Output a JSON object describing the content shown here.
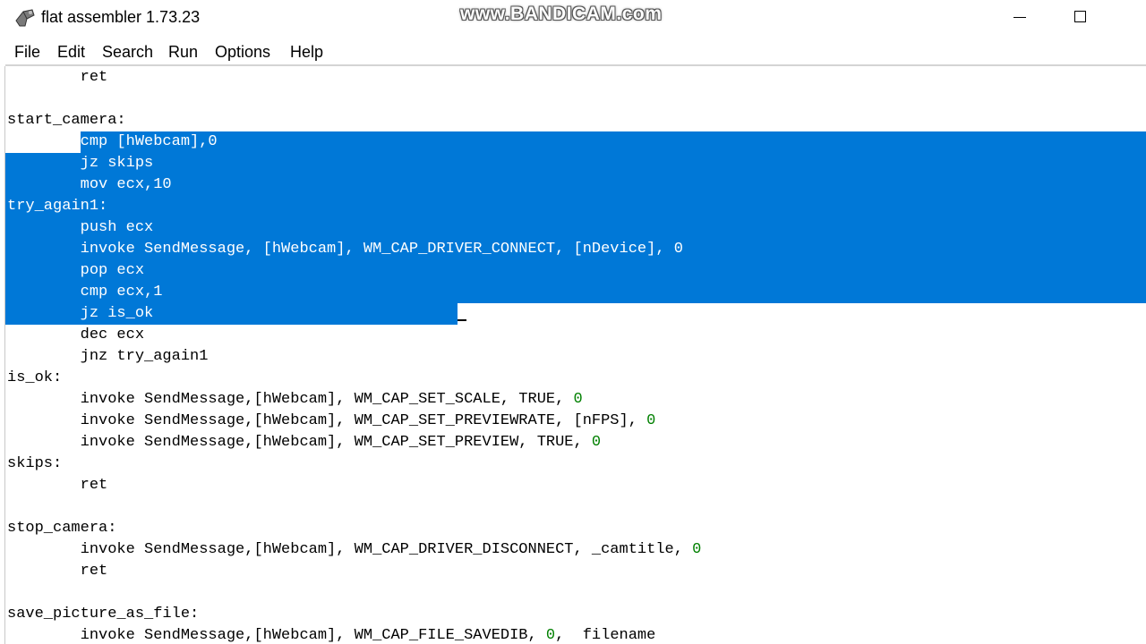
{
  "window": {
    "title": "flat assembler 1.73.23",
    "watermark": "www.BANDICAM.com",
    "app_icon": "fasm-icon",
    "controls": [
      "minimize-icon",
      "maximize-icon"
    ]
  },
  "menu": [
    "File",
    "Edit",
    "Search",
    "Run",
    "Options",
    "Help"
  ],
  "colors": {
    "selection": "#0078d7",
    "number": "#008000",
    "text": "#000000"
  },
  "editor": {
    "lines": [
      {
        "text": "        ret"
      },
      {
        "text": ""
      },
      {
        "text": "start_camera:"
      },
      {
        "text": "        cmp [hWebcam],0",
        "selected": true
      },
      {
        "text": "        jz skips",
        "selected": true
      },
      {
        "text": "        mov ecx,10",
        "selected": true
      },
      {
        "text": "try_again1:",
        "selected": true
      },
      {
        "text": "        push ecx",
        "selected": true
      },
      {
        "text": "        invoke SendMessage, [hWebcam], WM_CAP_DRIVER_CONNECT, [nDevice], 0",
        "selected": true
      },
      {
        "text": "        pop ecx",
        "selected": true
      },
      {
        "text": "        cmp ecx,1",
        "selected": true
      },
      {
        "text": "        jz is_ok",
        "selected": true
      },
      {
        "text": "        dec ecx"
      },
      {
        "text": "        jnz try_again1"
      },
      {
        "text": "is_ok:"
      },
      {
        "text": "        invoke SendMessage,[hWebcam], WM_CAP_SET_SCALE, TRUE, ",
        "tail": "0"
      },
      {
        "text": "        invoke SendMessage,[hWebcam], WM_CAP_SET_PREVIEWRATE, [nFPS], ",
        "tail": "0"
      },
      {
        "text": "        invoke SendMessage,[hWebcam], WM_CAP_SET_PREVIEW, TRUE, ",
        "tail": "0"
      },
      {
        "text": "skips:"
      },
      {
        "text": "        ret"
      },
      {
        "text": ""
      },
      {
        "text": "stop_camera:"
      },
      {
        "text": "        invoke SendMessage,[hWebcam], WM_CAP_DRIVER_DISCONNECT, _camtitle, ",
        "tail": "0"
      },
      {
        "text": "        ret"
      },
      {
        "text": ""
      },
      {
        "text": "save_picture_as_file:"
      },
      {
        "text": "        invoke SendMessage,[hWebcam], WM_CAP_FILE_SAVEDIB, ",
        "tail": "0",
        "after": ",  filename"
      }
    ]
  }
}
